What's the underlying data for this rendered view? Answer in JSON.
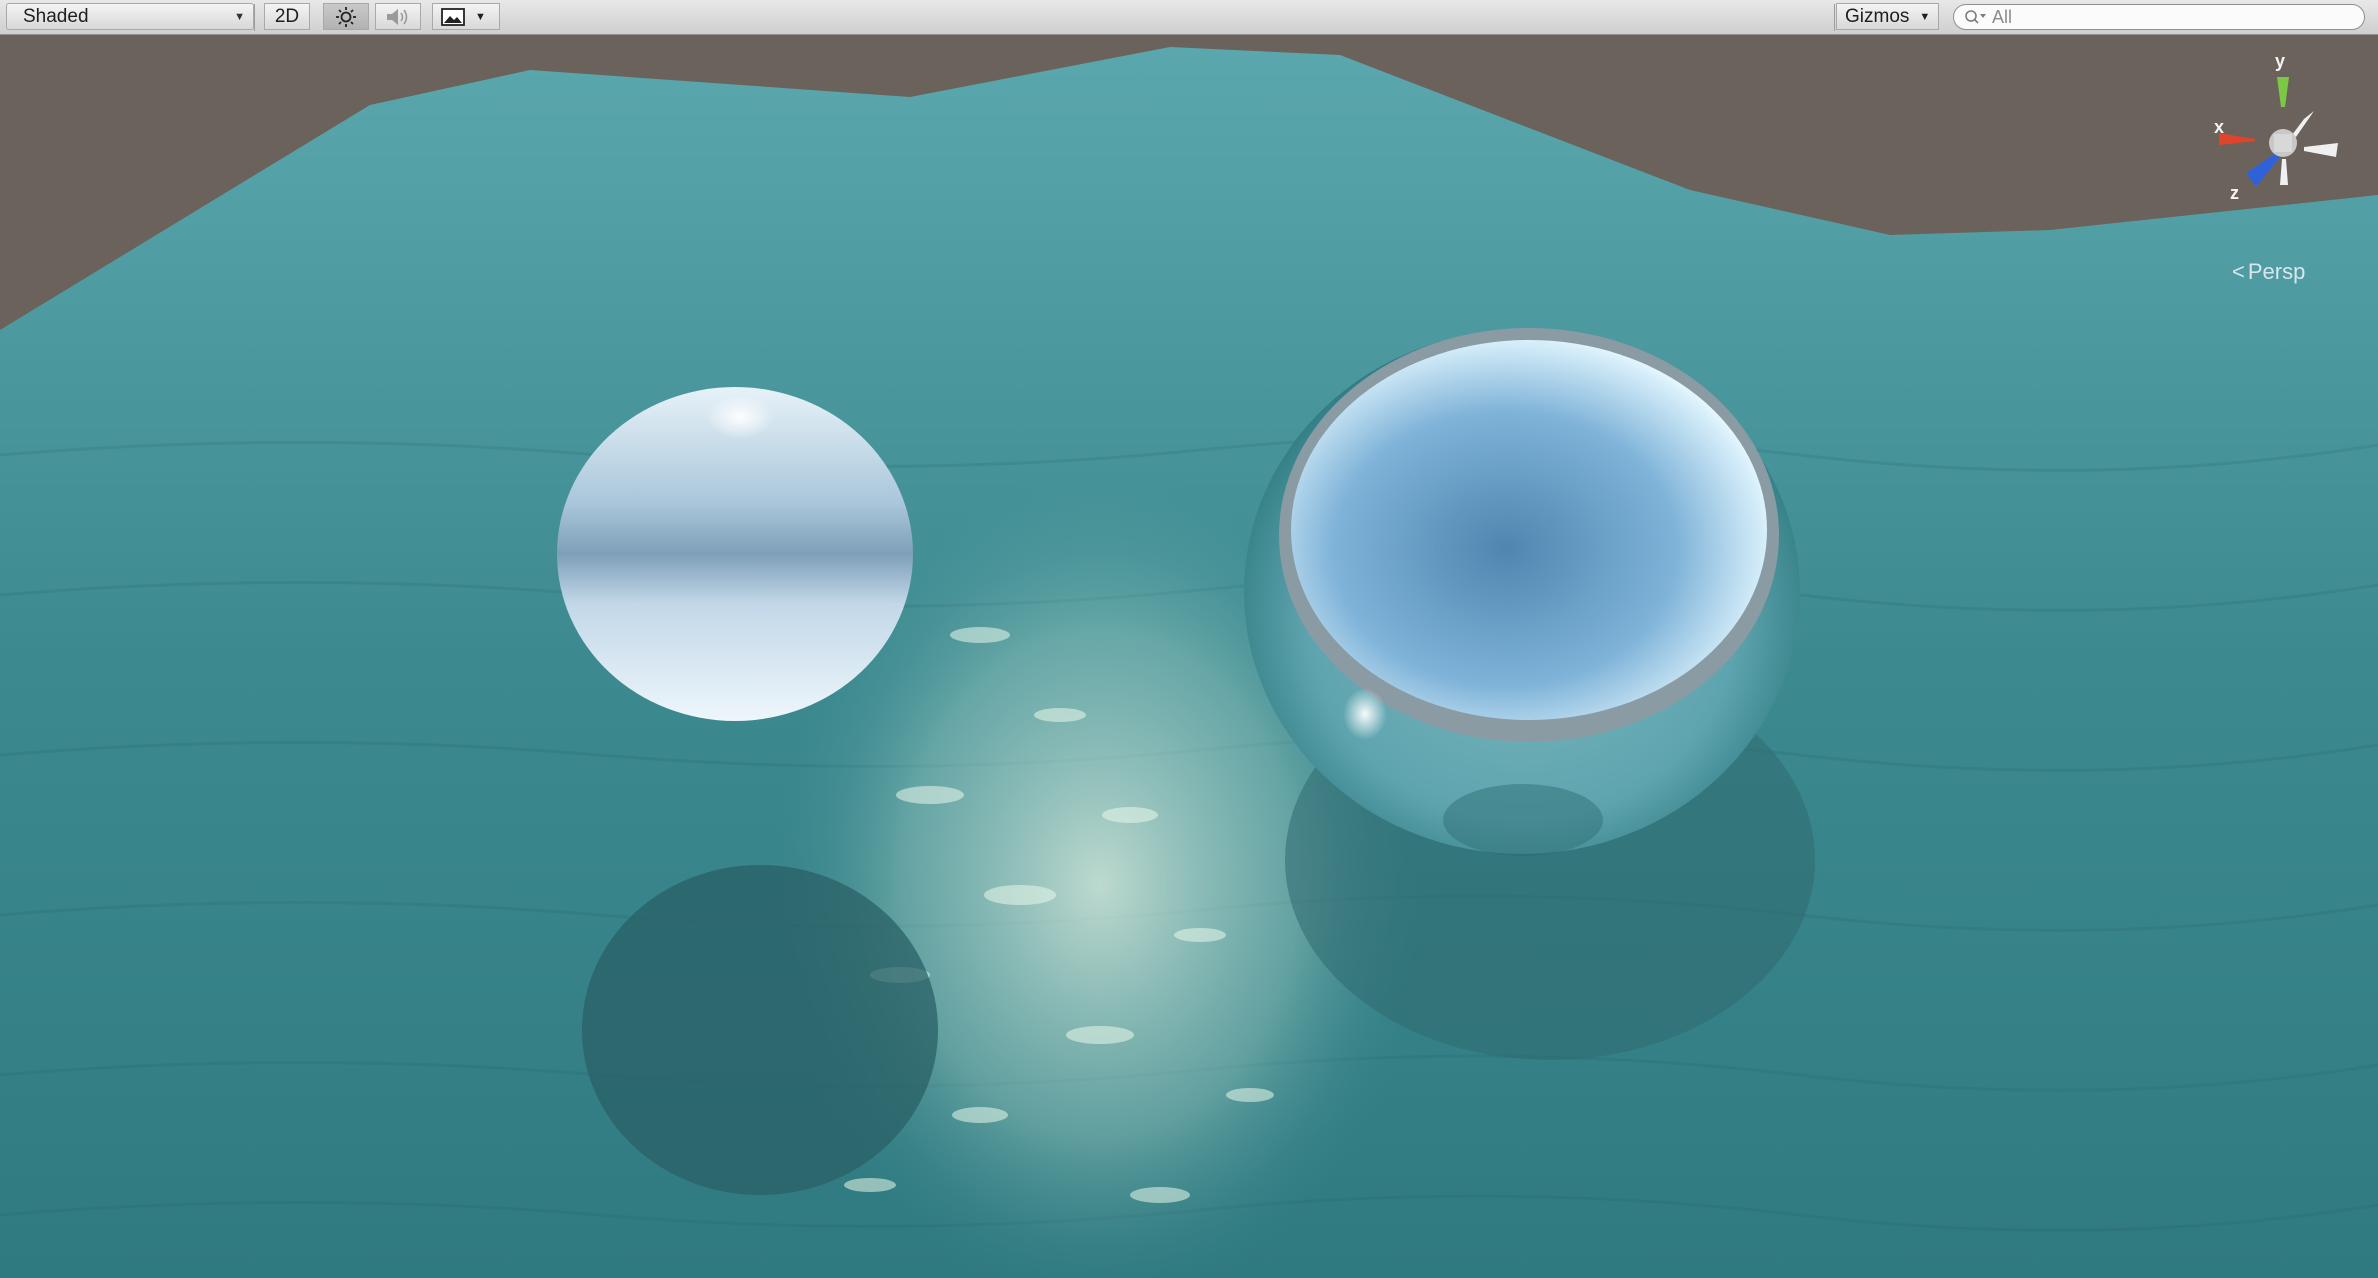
{
  "toolbar": {
    "shading_mode": "Shaded",
    "mode_2d_label": "2D",
    "lighting_icon": "sun-icon",
    "audio_icon": "speaker-icon",
    "effects_icon": "image-icon",
    "gizmos_label": "Gizmos",
    "search_placeholder": "All"
  },
  "scene": {
    "gizmo_axes": {
      "x": "x",
      "y": "y",
      "z": "z"
    },
    "projection_label": "Persp"
  },
  "colors": {
    "water": "#3f8d92",
    "background": "#6b625c",
    "axis_x": "#e0442b",
    "axis_y": "#7ac843",
    "axis_z": "#2f62d8"
  }
}
